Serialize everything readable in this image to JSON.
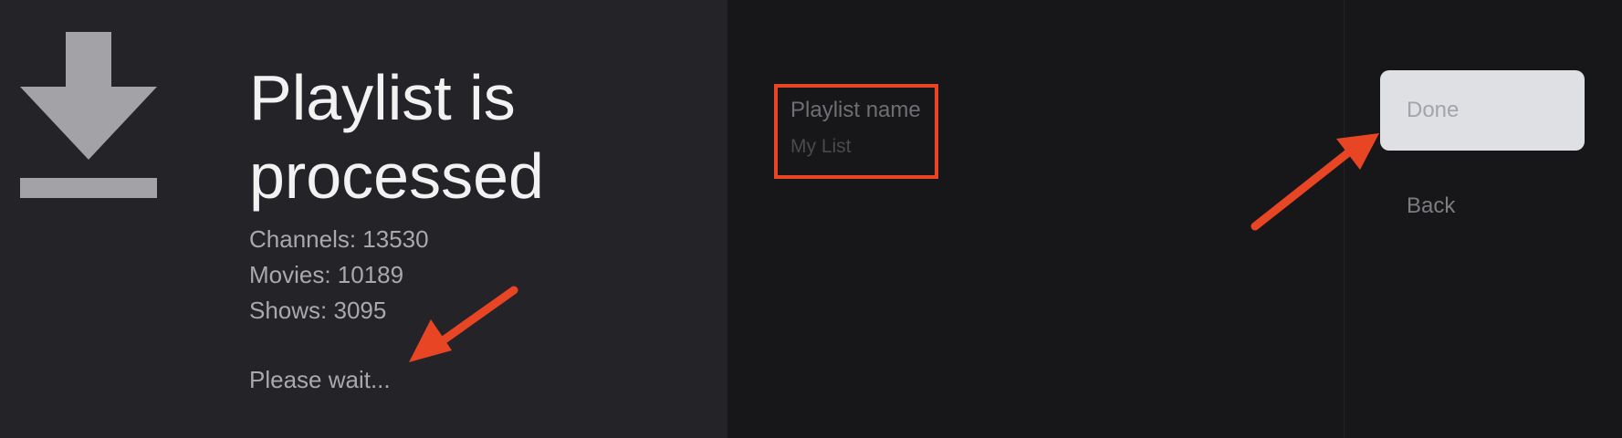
{
  "status": {
    "icon": "download-icon",
    "title": "Playlist is processed",
    "stats": [
      "Channels: 13530",
      "Movies: 10189",
      "Shows: 3095"
    ],
    "wait_text": "Please wait..."
  },
  "form": {
    "playlist_name_label": "Playlist name",
    "playlist_name_value": "My List"
  },
  "actions": {
    "done_label": "Done",
    "back_label": "Back"
  },
  "annotation": {
    "highlight_color": "#e84525"
  }
}
